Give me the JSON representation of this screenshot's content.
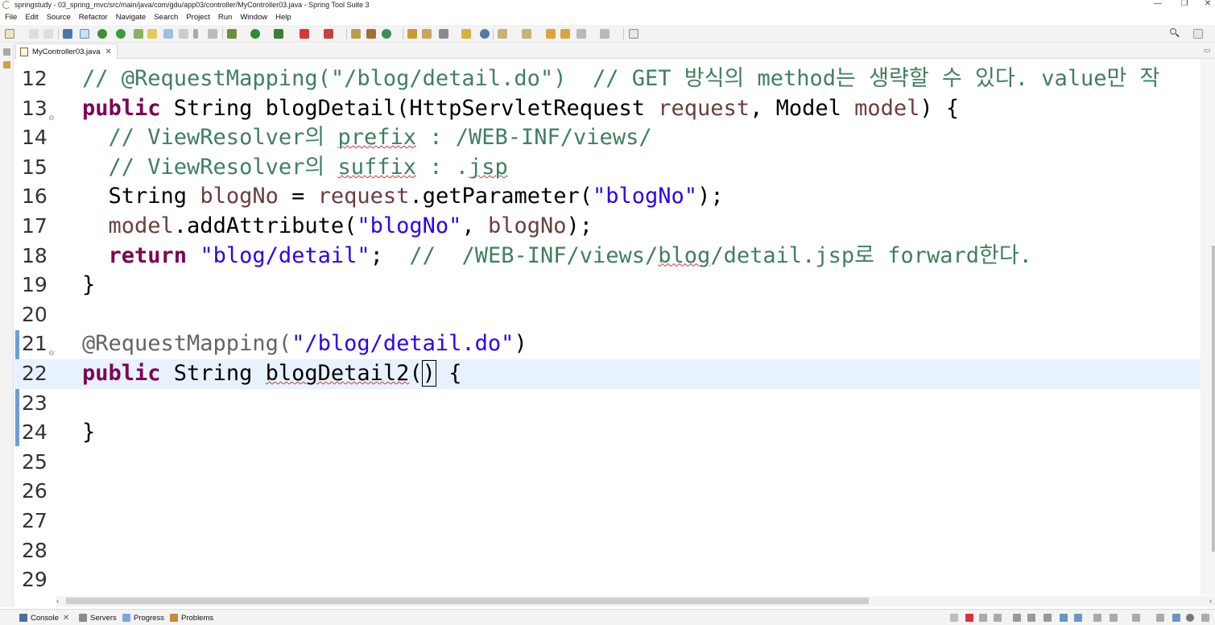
{
  "window": {
    "title": "springstudy - 03_spring_mvc/src/main/java/com/gdu/app03/controller/MyController03.java - Spring Tool Suite 3",
    "minimize": "—",
    "restore": "❐",
    "close": "✕"
  },
  "menu": [
    "File",
    "Edit",
    "Source",
    "Refactor",
    "Navigate",
    "Search",
    "Project",
    "Run",
    "Window",
    "Help"
  ],
  "editor_tab": {
    "label": "MyController03.java",
    "close": "✕"
  },
  "bottom_tabs": [
    {
      "label": "Console",
      "close": "✕"
    },
    {
      "label": "Servers"
    },
    {
      "label": "Progress"
    },
    {
      "label": "Problems"
    }
  ],
  "line_numbers": [
    "12",
    "13",
    "14",
    "15",
    "16",
    "17",
    "18",
    "19",
    "20",
    "21",
    "22",
    "23",
    "24",
    "25",
    "26",
    "27",
    "28",
    "29"
  ],
  "code": {
    "l12": "// @RequestMapping(\"/blog/detail.do\")  // GET 방식의 method는 생략할 수 있다. value만 작",
    "l13_kw": "public",
    "l13_a": " String blogDetail(HttpServletRequest ",
    "l13_var1": "request",
    "l13_b": ", Model ",
    "l13_var2": "model",
    "l13_c": ") {",
    "l14_a": "  // ViewResolver의 ",
    "l14_sq": "prefix",
    "l14_b": " : /WEB-INF/views/",
    "l15_a": "  // ViewResolver의 ",
    "l15_sq": "suffix",
    "l15_b": " : .",
    "l15_sq2": "jsp",
    "l16_a": "  String ",
    "l16_var1": "blogNo",
    "l16_b": " = ",
    "l16_var2": "request",
    "l16_c": ".getParameter(",
    "l16_str": "\"blogNo\"",
    "l16_d": ");",
    "l17_var1": "  model",
    "l17_a": ".addAttribute(",
    "l17_str": "\"blogNo\"",
    "l17_b": ", ",
    "l17_var2": "blogNo",
    "l17_c": ");",
    "l18_kw": "  return",
    "l18_a": " ",
    "l18_str": "\"blog/detail\"",
    "l18_b": ";  ",
    "l18_cm_a": "//  /WEB-INF/views/",
    "l18_cm_sq": "blog",
    "l18_cm_b": "/detail.jsp로 forward한다.",
    "l19": "}",
    "l21_ann": "@RequestMapping(",
    "l21_str": "\"/blog/detail.do\"",
    "l21_a": ")",
    "l22_kw": "public",
    "l22_a": " String ",
    "l22_sq": "blogDetail2",
    "l22_b": "(",
    "l22_caret": ")",
    "l22_c": " {",
    "l24": "}"
  },
  "colors": {
    "comment": "#3f7f5f",
    "keyword": "#7f0055",
    "string": "#2a00ff",
    "annotation": "#646464",
    "variable": "#6a3e3e",
    "current_line": "#e8f2fe"
  },
  "icons": {
    "search": "search-icon"
  }
}
